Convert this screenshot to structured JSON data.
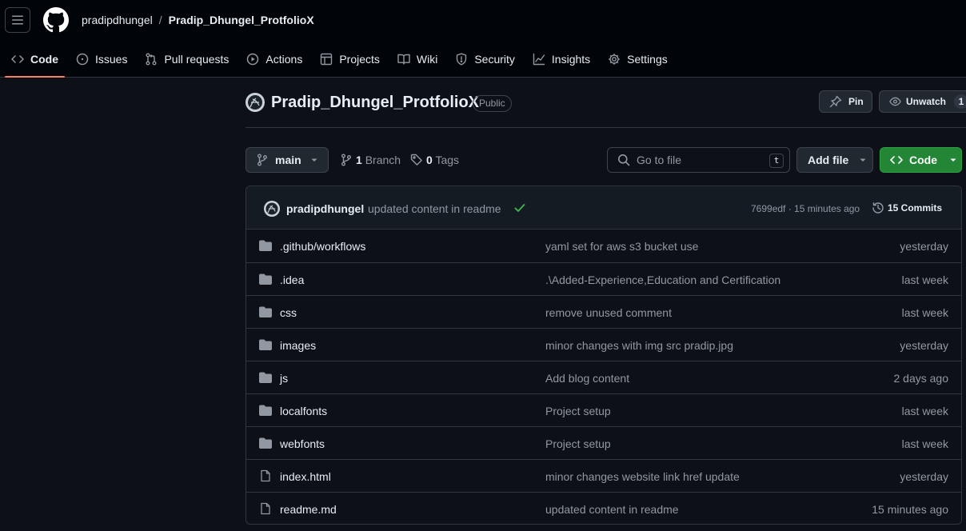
{
  "header": {
    "owner": "pradipdhungel",
    "separator": "/",
    "repo": "Pradip_Dhungel_ProtfolioX"
  },
  "nav": {
    "tabs": [
      {
        "label": "Code",
        "icon": "code-icon"
      },
      {
        "label": "Issues",
        "icon": "issue-icon"
      },
      {
        "label": "Pull requests",
        "icon": "pull-request-icon"
      },
      {
        "label": "Actions",
        "icon": "play-icon"
      },
      {
        "label": "Projects",
        "icon": "table-icon"
      },
      {
        "label": "Wiki",
        "icon": "book-icon"
      },
      {
        "label": "Security",
        "icon": "shield-icon"
      },
      {
        "label": "Insights",
        "icon": "graph-icon"
      },
      {
        "label": "Settings",
        "icon": "gear-icon"
      }
    ]
  },
  "repo": {
    "title": "Pradip_Dhungel_ProtfolioX",
    "visibility": "Public",
    "pin_label": "Pin",
    "watch_label": "Unwatch",
    "watch_count": "1"
  },
  "toolbar": {
    "branch": "main",
    "branch_count": "1",
    "branch_word": "Branch",
    "tag_count": "0",
    "tag_word": "Tags",
    "goto_placeholder": "Go to file",
    "goto_shortcut": "t",
    "add_file_label": "Add file",
    "code_label": "Code"
  },
  "commit": {
    "author": "pradipdhungel",
    "message": "updated content in readme",
    "hash_time": "7699edf · 15 minutes ago",
    "commits_label": "15 Commits"
  },
  "files": [
    {
      "name": ".github/workflows",
      "type": "folder",
      "message": "yaml set for aws s3 bucket use",
      "date": "yesterday"
    },
    {
      "name": ".idea",
      "type": "folder",
      "message": ".\\Added-Experience,Education and Certification",
      "date": "last week"
    },
    {
      "name": "css",
      "type": "folder",
      "message": "remove unused comment",
      "date": "last week"
    },
    {
      "name": "images",
      "type": "folder",
      "message": "minor changes with img src pradip.jpg",
      "date": "yesterday"
    },
    {
      "name": "js",
      "type": "folder",
      "message": "Add blog content",
      "date": "2 days ago"
    },
    {
      "name": "localfonts",
      "type": "folder",
      "message": "Project setup",
      "date": "last week"
    },
    {
      "name": "webfonts",
      "type": "folder",
      "message": "Project setup",
      "date": "last week"
    },
    {
      "name": "index.html",
      "type": "file",
      "message": "minor changes website link href update",
      "date": "yesterday"
    },
    {
      "name": "readme.md",
      "type": "file",
      "message": "updated content in readme",
      "date": "15 minutes ago"
    }
  ],
  "colors": {
    "background": "#0d1117",
    "header": "#010409",
    "accent_underline": "#f78166",
    "primary_button": "#238636",
    "success_check": "#3fb950"
  }
}
